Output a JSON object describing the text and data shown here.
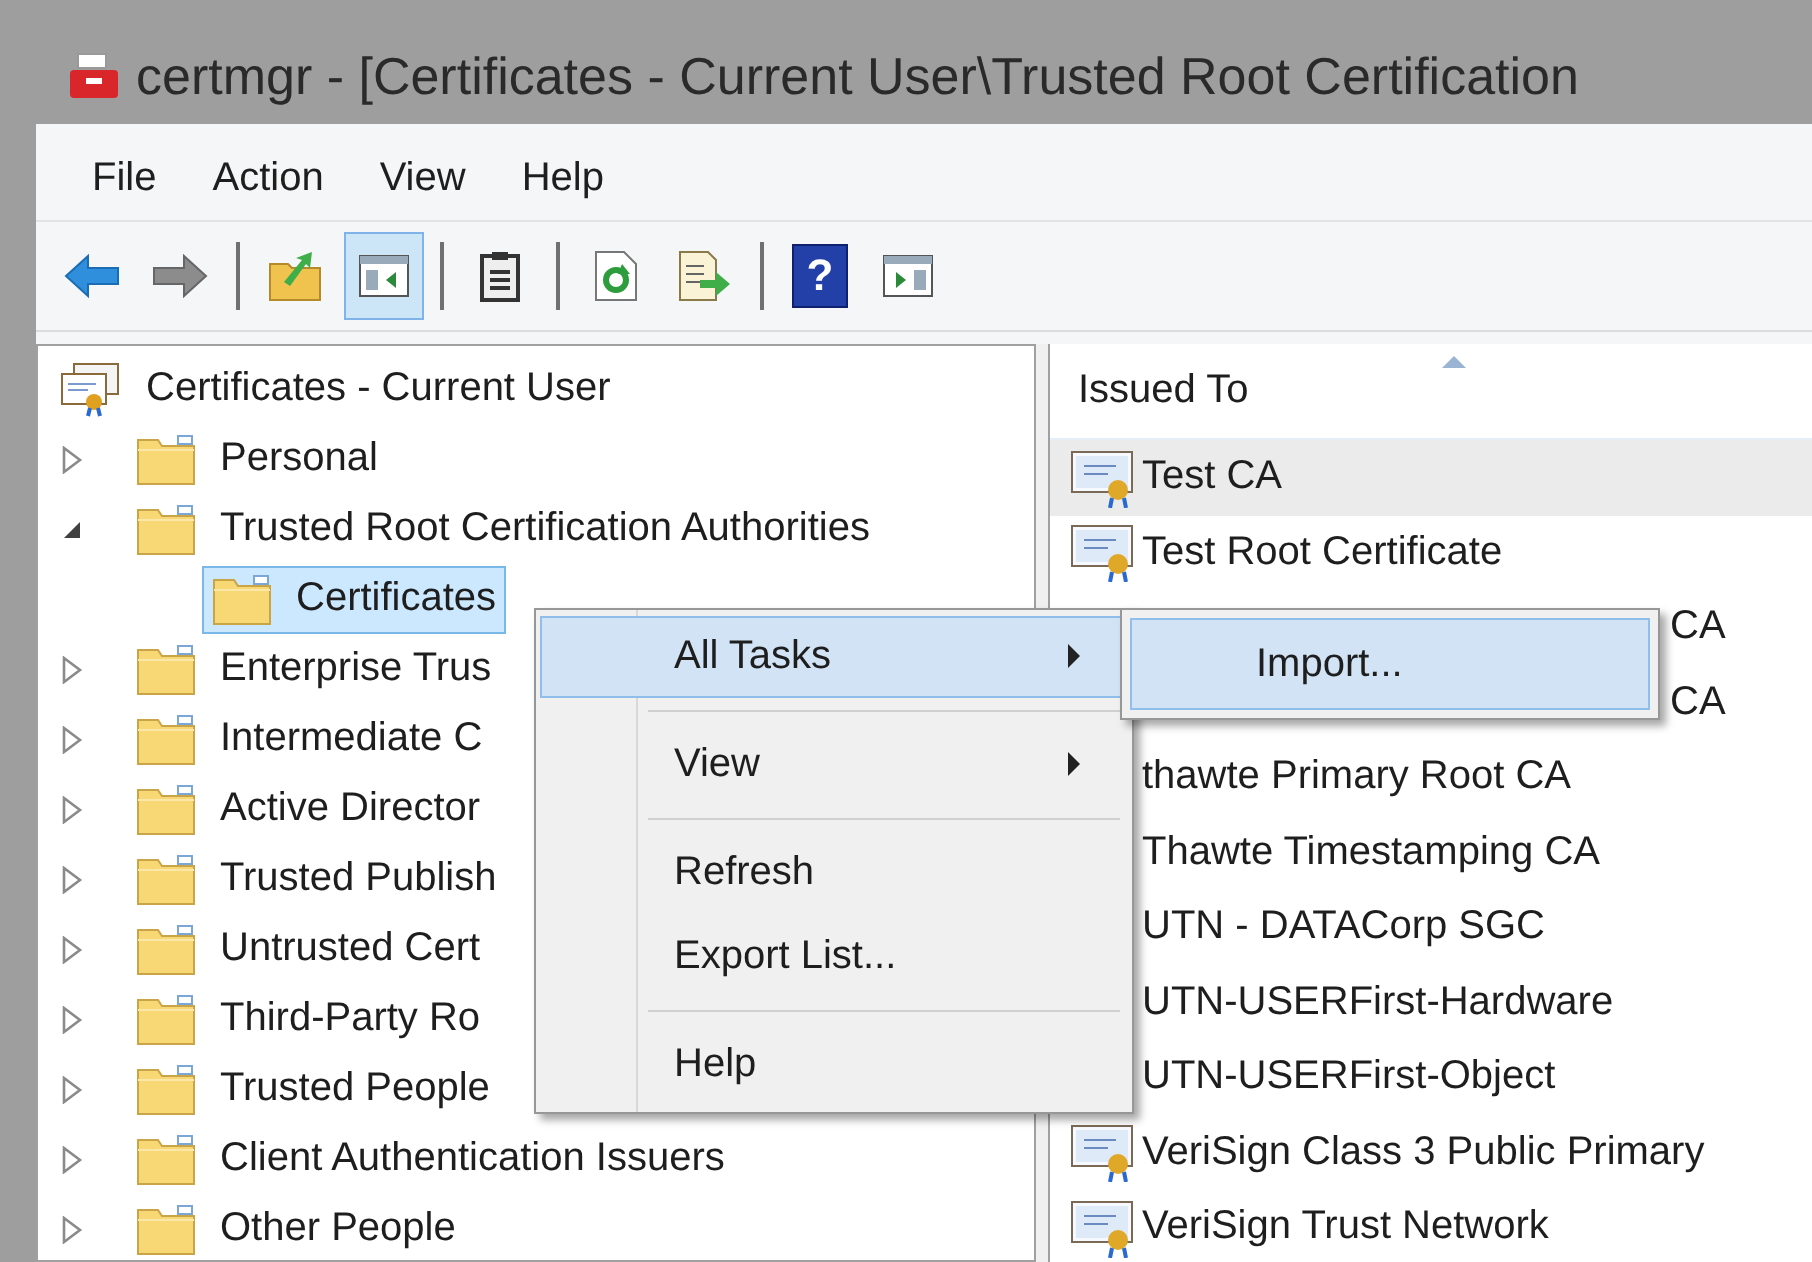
{
  "window": {
    "title": "certmgr - [Certificates - Current User\\Trusted Root Certification"
  },
  "menu_bar": [
    "File",
    "Action",
    "View",
    "Help"
  ],
  "toolbar": [
    {
      "kind": "back",
      "pressed": false
    },
    {
      "kind": "forward",
      "pressed": false
    },
    {
      "kind": "separator"
    },
    {
      "kind": "up",
      "pressed": false
    },
    {
      "kind": "tree-toggle",
      "pressed": true
    },
    {
      "kind": "separator"
    },
    {
      "kind": "properties",
      "pressed": false
    },
    {
      "kind": "separator"
    },
    {
      "kind": "refresh",
      "pressed": false
    },
    {
      "kind": "export",
      "pressed": false
    },
    {
      "kind": "separator"
    },
    {
      "kind": "help",
      "pressed": false,
      "glyph": "?"
    },
    {
      "kind": "action-pane",
      "pressed": false
    }
  ],
  "tree": {
    "label": "Certificates - Current User",
    "selected": false,
    "children": [
      {
        "label": "Personal",
        "expanded": false,
        "selected": false
      },
      {
        "label": "Trusted Root Certification Authorities",
        "expanded": true,
        "selected": false,
        "children": [
          {
            "label": "Certificates",
            "selected": true
          }
        ]
      },
      {
        "label": "Enterprise Trus",
        "expanded": false,
        "selected": false
      },
      {
        "label": "Intermediate C",
        "expanded": false,
        "selected": false
      },
      {
        "label": "Active Director",
        "expanded": false,
        "selected": false
      },
      {
        "label": "Trusted Publish",
        "expanded": false,
        "selected": false
      },
      {
        "label": "Untrusted Cert",
        "expanded": false,
        "selected": false
      },
      {
        "label": "Third-Party Ro",
        "expanded": false,
        "selected": false
      },
      {
        "label": "Trusted People",
        "expanded": false,
        "selected": false
      },
      {
        "label": "Client Authentication Issuers",
        "expanded": false,
        "selected": false
      },
      {
        "label": "Other People",
        "expanded": false,
        "selected": false
      }
    ]
  },
  "list": {
    "column": "Issued To",
    "sorted": true,
    "rows": [
      {
        "kind": "full",
        "text": "Test CA",
        "selected": true
      },
      {
        "kind": "full",
        "text": "Test Root Certificate",
        "selected": false
      },
      {
        "kind": "tail",
        "text": "CA",
        "selected": false
      },
      {
        "kind": "tail",
        "text": "CA",
        "selected": false
      },
      {
        "kind": "full",
        "text": "thawte Primary Root CA",
        "selected": false
      },
      {
        "kind": "full",
        "text": "Thawte Timestamping CA",
        "selected": false
      },
      {
        "kind": "full",
        "text": "UTN - DATACorp SGC",
        "selected": false
      },
      {
        "kind": "full",
        "text": "UTN-USERFirst-Hardware",
        "selected": false
      },
      {
        "kind": "full",
        "text": "UTN-USERFirst-Object",
        "selected": false
      },
      {
        "kind": "full",
        "text": "VeriSign Class 3 Public Primary",
        "selected": false
      },
      {
        "kind": "full",
        "text": "VeriSign Trust Network",
        "selected": false
      }
    ]
  },
  "context_menu": {
    "items": [
      {
        "kind": "item",
        "label": "All Tasks",
        "submenu": true,
        "selected": true
      },
      {
        "kind": "separator"
      },
      {
        "kind": "item",
        "label": "View",
        "submenu": true,
        "selected": false
      },
      {
        "kind": "separator"
      },
      {
        "kind": "item",
        "label": "Refresh",
        "submenu": false,
        "selected": false
      },
      {
        "kind": "item",
        "label": "Export List...",
        "submenu": false,
        "selected": false
      },
      {
        "kind": "separator"
      },
      {
        "kind": "item",
        "label": "Help",
        "submenu": false,
        "selected": false
      }
    ]
  },
  "submenu": {
    "items": [
      {
        "label": "Import...",
        "selected": true
      }
    ]
  }
}
